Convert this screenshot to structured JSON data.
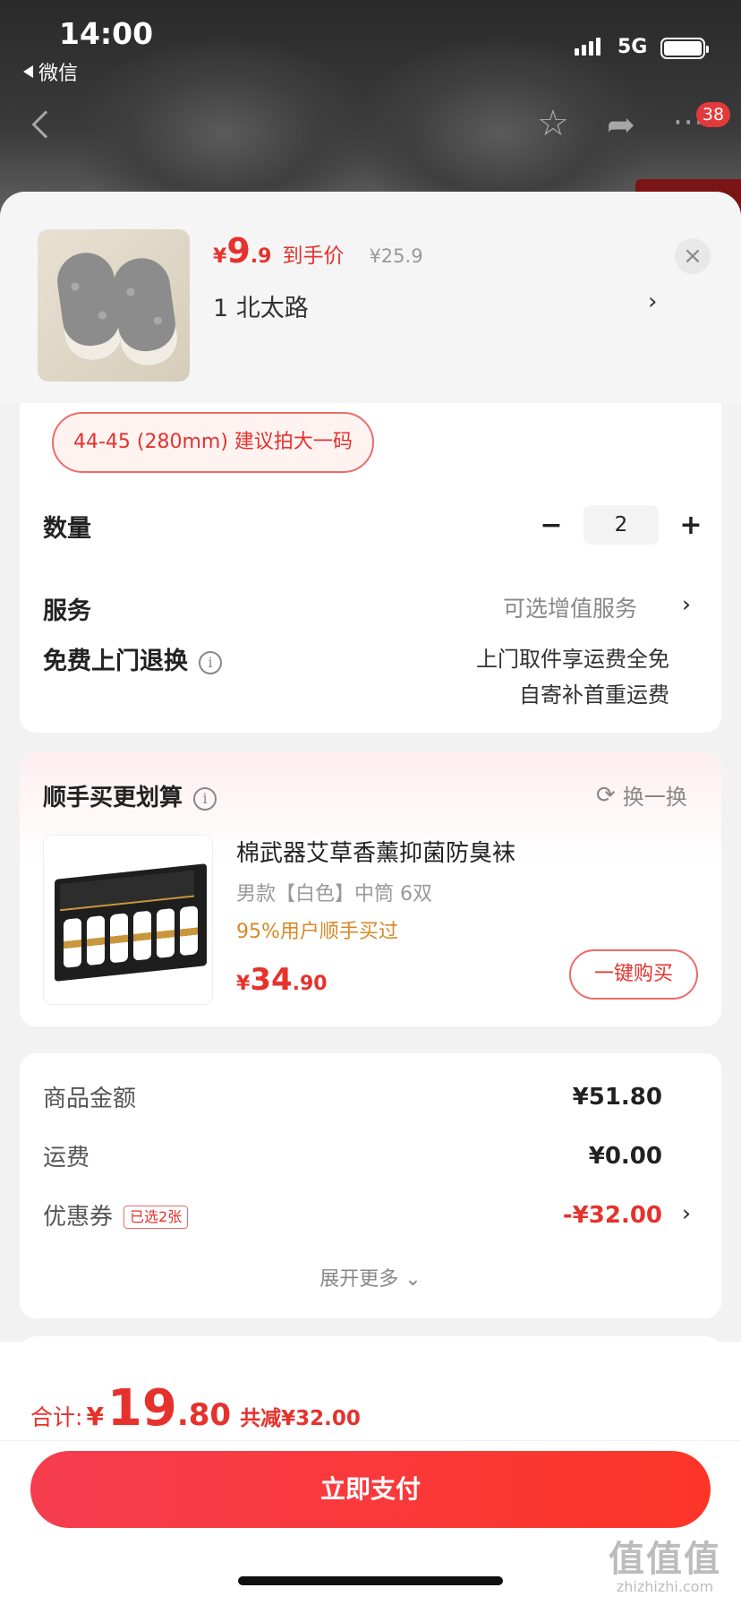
{
  "status_bar": {
    "time": "14:00",
    "back_app": "微信",
    "network": "5G"
  },
  "top_nav": {
    "badge_count": "38",
    "icons": [
      "back-icon",
      "star-icon",
      "share-icon",
      "more-icon"
    ]
  },
  "product": {
    "price_symbol": "¥",
    "price_int": "9",
    "price_dec": ".9",
    "price_tag": "到手价",
    "original_price": "¥25.9",
    "spec": "1  北太路",
    "spec_chevron": "›",
    "close": "×"
  },
  "size_chip": "44-45 (280mm) 建议拍大一码",
  "quantity": {
    "label": "数量",
    "minus": "−",
    "value": "2",
    "plus": "+"
  },
  "service": {
    "label": "服务",
    "value": "可选增值服务",
    "chevron": "›"
  },
  "free_return": {
    "label": "免费上门退换",
    "info": "i",
    "line1": "上门取件享运费全免",
    "line2": "自寄补首重运费"
  },
  "addon": {
    "title": "顺手买更划算",
    "info": "i",
    "swap_icon": "⟳",
    "swap_label": "换一换",
    "item": {
      "name": "棉武器艾草香薰抑菌防臭袜",
      "spec": "男款【白色】中筒 6双",
      "bought": "95%用户顺手买过",
      "price_symbol": "¥",
      "price_int": "34",
      "price_dec": ".90",
      "buy_label": "一键购买"
    }
  },
  "summary": {
    "goods_label": "商品金额",
    "goods_value": "¥51.80",
    "shipping_label": "运费",
    "shipping_value": "¥0.00",
    "coupon_label": "优惠券",
    "coupon_tag": "已选2张",
    "coupon_value": "-¥32.00",
    "coupon_chevron": "›",
    "expand": "展开更多 ⌄"
  },
  "bottom": {
    "total_label": "合计:",
    "total_symbol": "¥",
    "total_int": "19",
    "total_dec": ".80",
    "total_reduce": "共减¥32.00",
    "pay_label": "立即支付"
  },
  "watermark": {
    "logo": "值值值",
    "url": "zhizhizhi.com"
  },
  "colors": {
    "accent": "#e5322d",
    "pay_start": "#f53d4f",
    "pay_end": "#fd3527",
    "bought": "#d68a28"
  }
}
